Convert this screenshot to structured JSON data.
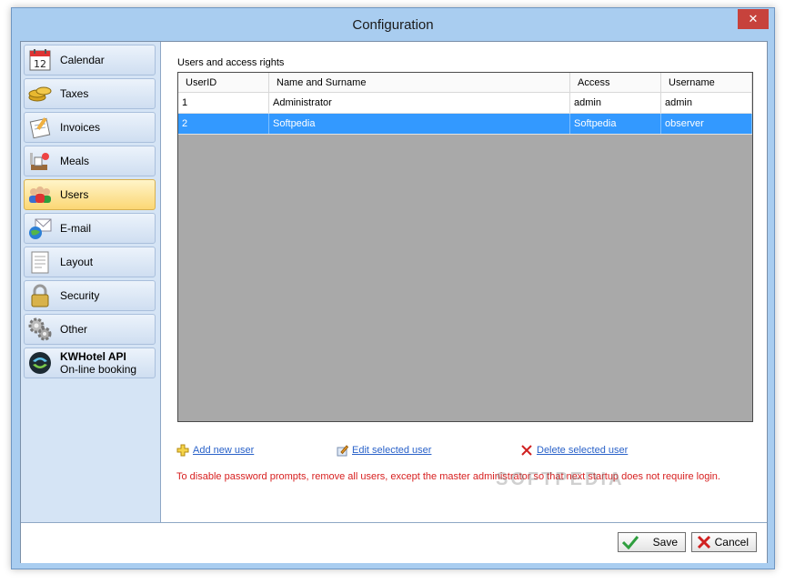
{
  "window": {
    "title": "Configuration",
    "close_glyph": "✕"
  },
  "sidebar": {
    "items": [
      {
        "label": "Calendar",
        "icon": "calendar-icon"
      },
      {
        "label": "Taxes",
        "icon": "coins-icon"
      },
      {
        "label": "Invoices",
        "icon": "invoice-icon"
      },
      {
        "label": "Meals",
        "icon": "meals-icon"
      },
      {
        "label": "Users",
        "icon": "users-icon",
        "active": true
      },
      {
        "label": "E-mail",
        "icon": "email-globe-icon"
      },
      {
        "label": "Layout",
        "icon": "layout-icon"
      },
      {
        "label": "Security",
        "icon": "padlock-icon"
      },
      {
        "label": "Other",
        "icon": "gears-icon"
      },
      {
        "label": "KWHotel API",
        "sublabel": "On-line booking",
        "icon": "api-globe-icon"
      }
    ],
    "calendar_day": "12"
  },
  "main": {
    "section_title": "Users and access rights",
    "table": {
      "columns": [
        "UserID",
        "Name and Surname",
        "Access",
        "Username"
      ],
      "rows": [
        {
          "id": "1",
          "name": "Administrator",
          "access": "admin",
          "username": "admin",
          "selected": false
        },
        {
          "id": "2",
          "name": "Softpedia",
          "access": "Softpedia",
          "username": "observer",
          "selected": true
        }
      ]
    },
    "actions": {
      "add": "Add new user",
      "edit": "Edit selected user",
      "delete": "Delete selected user"
    },
    "warning": "To disable password prompts, remove all users, except the master administrator so that next startup does not require login."
  },
  "footer": {
    "save_label": "Save",
    "cancel_label": "Cancel"
  },
  "watermark": "SOFTPEDIA",
  "colors": {
    "accent": "#3399ff",
    "warning": "#d71f1f",
    "link": "#2a62c9"
  }
}
